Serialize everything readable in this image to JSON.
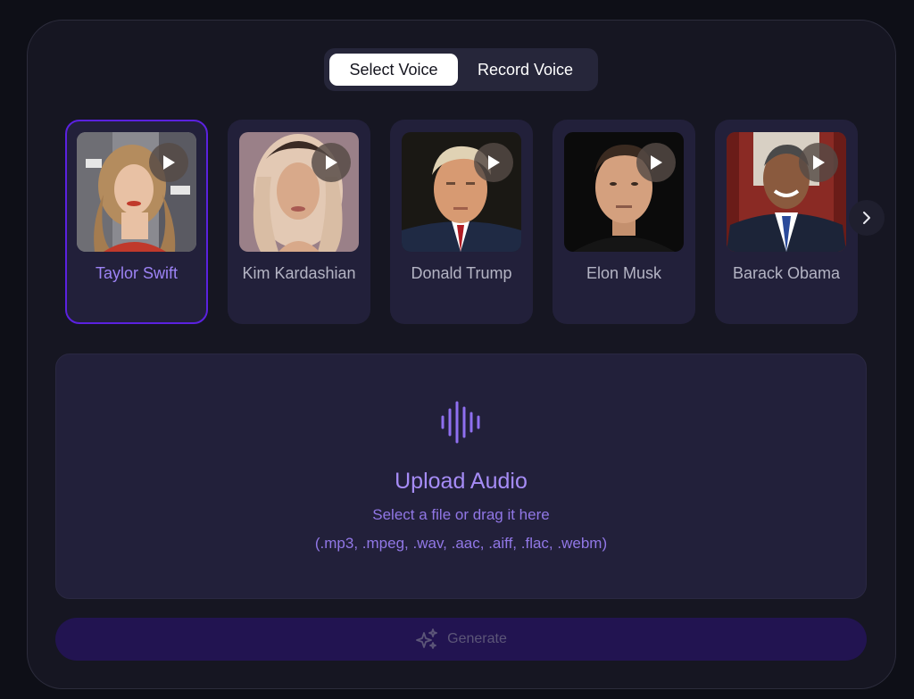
{
  "tabs": [
    {
      "label": "Select Voice",
      "active": true
    },
    {
      "label": "Record Voice",
      "active": false
    }
  ],
  "voices": [
    {
      "name": "Taylor Swift",
      "selected": true,
      "icon": "play-icon"
    },
    {
      "name": "Kim Kardashian",
      "selected": false,
      "icon": "play-icon"
    },
    {
      "name": "Donald Trump",
      "selected": false,
      "icon": "play-icon"
    },
    {
      "name": "Elon Musk",
      "selected": false,
      "icon": "play-icon"
    },
    {
      "name": "Barack Obama",
      "selected": false,
      "icon": "play-icon"
    }
  ],
  "upload": {
    "icon": "audio-waveform-icon",
    "title": "Upload Audio",
    "subtitle": "Select a file or drag it here",
    "formats": "(.mp3, .mpeg, .wav, .aac, .aiff, .flac, .webm)"
  },
  "generate": {
    "icon": "sparkles-icon",
    "label": "Generate"
  },
  "colors": {
    "accent": "#5b21e0",
    "accent_text": "#9d83f5",
    "panel_bg": "#161622",
    "card_bg": "#22203a"
  }
}
